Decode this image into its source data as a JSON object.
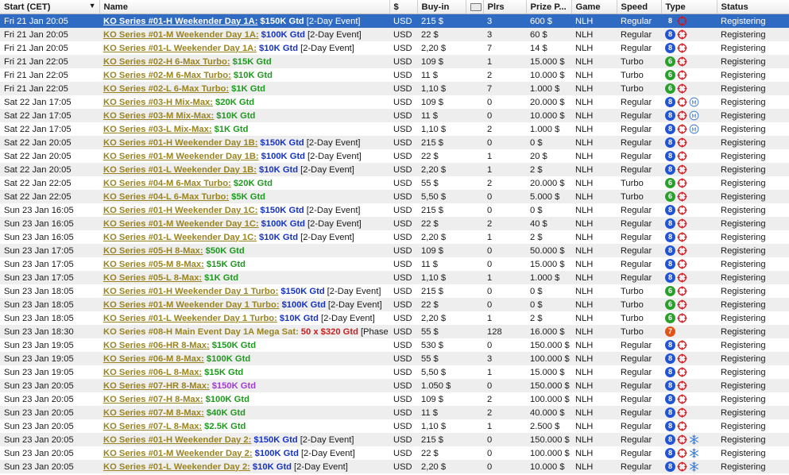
{
  "columns": {
    "start": "Start (CET)",
    "name": "Name",
    "currency": "$",
    "buyin": "Buy-in",
    "ticket": "",
    "players": "Plrs",
    "prize": "Prize P...",
    "game": "Game",
    "speed": "Speed",
    "type": "Type",
    "status": "Status"
  },
  "icons": {
    "start_sort": "caret-down-icon",
    "ticket": "ticket-icon",
    "bounty": "crosshair-icon",
    "mix": "m-circle-icon",
    "freeze": "snowflake-icon"
  },
  "colors": {
    "selected_row": "#2f6bc2",
    "alt_row": "#eeeeee",
    "name_gold": "#9a8420",
    "gtd_blue": "#1633c7",
    "gtd_green": "#1e9a1e",
    "gtd_purple": "#a13cd0",
    "gtd_red": "#c62020",
    "badge_8": "#1f55d4",
    "badge_6": "#27a127",
    "badge_7": "#e0541a",
    "bounty_red": "#d0161d",
    "mix_blue": "#3a78d8",
    "freeze_blue": "#3c7fe0"
  },
  "rows": [
    {
      "start": "Fri 21 Jan 20:05",
      "name": "KO Series #01-H Weekender Day 1A:",
      "gtd": "$150K Gtd",
      "gtd_color": "blue",
      "suffix": "[2-Day Event]",
      "currency": "USD",
      "buyin": "215 $",
      "players": "3",
      "prize": "600 $",
      "game": "NLH",
      "speed": "Regular",
      "badge": "8",
      "icons": [
        "bounty"
      ],
      "status": "Registering",
      "selected": true
    },
    {
      "start": "Fri 21 Jan 20:05",
      "name": "KO Series #01-M Weekender Day 1A:",
      "gtd": "$100K Gtd",
      "gtd_color": "blue",
      "suffix": "[2-Day Event]",
      "currency": "USD",
      "buyin": "22 $",
      "players": "3",
      "prize": "60 $",
      "game": "NLH",
      "speed": "Regular",
      "badge": "8",
      "icons": [
        "bounty"
      ],
      "status": "Registering"
    },
    {
      "start": "Fri 21 Jan 20:05",
      "name": "KO Series #01-L Weekender Day 1A:",
      "gtd": "$10K Gtd",
      "gtd_color": "blue",
      "suffix": "[2-Day Event]",
      "currency": "USD",
      "buyin": "2,20 $",
      "players": "7",
      "prize": "14 $",
      "game": "NLH",
      "speed": "Regular",
      "badge": "8",
      "icons": [
        "bounty"
      ],
      "status": "Registering"
    },
    {
      "start": "Fri 21 Jan 22:05",
      "name": "KO Series #02-H 6-Max Turbo:",
      "gtd": "$15K Gtd",
      "gtd_color": "green",
      "suffix": "",
      "currency": "USD",
      "buyin": "109 $",
      "players": "1",
      "prize": "15.000 $",
      "game": "NLH",
      "speed": "Turbo",
      "badge": "6",
      "icons": [
        "bounty"
      ],
      "status": "Registering"
    },
    {
      "start": "Fri 21 Jan 22:05",
      "name": "KO Series #02-M 6-Max Turbo:",
      "gtd": "$10K Gtd",
      "gtd_color": "green",
      "suffix": "",
      "currency": "USD",
      "buyin": "11 $",
      "players": "2",
      "prize": "10.000 $",
      "game": "NLH",
      "speed": "Turbo",
      "badge": "6",
      "icons": [
        "bounty"
      ],
      "status": "Registering"
    },
    {
      "start": "Fri 21 Jan 22:05",
      "name": "KO Series #02-L 6-Max Turbo:",
      "gtd": "$1K Gtd",
      "gtd_color": "green",
      "suffix": "",
      "currency": "USD",
      "buyin": "1,10 $",
      "players": "7",
      "prize": "1.000 $",
      "game": "NLH",
      "speed": "Turbo",
      "badge": "6",
      "icons": [
        "bounty"
      ],
      "status": "Registering"
    },
    {
      "start": "Sat 22 Jan 17:05",
      "name": "KO Series #03-H Mix-Max:",
      "gtd": "$20K Gtd",
      "gtd_color": "green",
      "suffix": "",
      "currency": "USD",
      "buyin": "109 $",
      "players": "0",
      "prize": "20.000 $",
      "game": "NLH",
      "speed": "Regular",
      "badge": "8",
      "icons": [
        "bounty",
        "mix"
      ],
      "status": "Registering"
    },
    {
      "start": "Sat 22 Jan 17:05",
      "name": "KO Series #03-M Mix-Max:",
      "gtd": "$10K Gtd",
      "gtd_color": "green",
      "suffix": "",
      "currency": "USD",
      "buyin": "11 $",
      "players": "0",
      "prize": "10.000 $",
      "game": "NLH",
      "speed": "Regular",
      "badge": "8",
      "icons": [
        "bounty",
        "mix"
      ],
      "status": "Registering"
    },
    {
      "start": "Sat 22 Jan 17:05",
      "name": "KO Series #03-L Mix-Max:",
      "gtd": "$1K Gtd",
      "gtd_color": "green",
      "suffix": "",
      "currency": "USD",
      "buyin": "1,10 $",
      "players": "2",
      "prize": "1.000 $",
      "game": "NLH",
      "speed": "Regular",
      "badge": "8",
      "icons": [
        "bounty",
        "mix"
      ],
      "status": "Registering"
    },
    {
      "start": "Sat 22 Jan 20:05",
      "name": "KO Series #01-H Weekender Day 1B:",
      "gtd": "$150K Gtd",
      "gtd_color": "blue",
      "suffix": "[2-Day Event]",
      "currency": "USD",
      "buyin": "215 $",
      "players": "0",
      "prize": "0 $",
      "game": "NLH",
      "speed": "Regular",
      "badge": "8",
      "icons": [
        "bounty"
      ],
      "status": "Registering"
    },
    {
      "start": "Sat 22 Jan 20:05",
      "name": "KO Series #01-M Weekender Day 1B:",
      "gtd": "$100K Gtd",
      "gtd_color": "blue",
      "suffix": "[2-Day Event]",
      "currency": "USD",
      "buyin": "22 $",
      "players": "1",
      "prize": "20 $",
      "game": "NLH",
      "speed": "Regular",
      "badge": "8",
      "icons": [
        "bounty"
      ],
      "status": "Registering"
    },
    {
      "start": "Sat 22 Jan 20:05",
      "name": "KO Series #01-L Weekender Day 1B:",
      "gtd": "$10K Gtd",
      "gtd_color": "blue",
      "suffix": "[2-Day Event]",
      "currency": "USD",
      "buyin": "2,20 $",
      "players": "1",
      "prize": "2 $",
      "game": "NLH",
      "speed": "Regular",
      "badge": "8",
      "icons": [
        "bounty"
      ],
      "status": "Registering"
    },
    {
      "start": "Sat 22 Jan 22:05",
      "name": "KO Series #04-M 6-Max Turbo:",
      "gtd": "$20K Gtd",
      "gtd_color": "green",
      "suffix": "",
      "currency": "USD",
      "buyin": "55 $",
      "players": "2",
      "prize": "20.000 $",
      "game": "NLH",
      "speed": "Turbo",
      "badge": "6",
      "icons": [
        "bounty"
      ],
      "status": "Registering"
    },
    {
      "start": "Sat 22 Jan 22:05",
      "name": "KO Series #04-L 6-Max Turbo:",
      "gtd": "$5K Gtd",
      "gtd_color": "green",
      "suffix": "",
      "currency": "USD",
      "buyin": "5,50 $",
      "players": "0",
      "prize": "5.000 $",
      "game": "NLH",
      "speed": "Turbo",
      "badge": "6",
      "icons": [
        "bounty"
      ],
      "status": "Registering"
    },
    {
      "start": "Sun 23 Jan 16:05",
      "name": "KO Series #01-H Weekender Day 1C:",
      "gtd": "$150K Gtd",
      "gtd_color": "blue",
      "suffix": "[2-Day Event]",
      "currency": "USD",
      "buyin": "215 $",
      "players": "0",
      "prize": "0 $",
      "game": "NLH",
      "speed": "Regular",
      "badge": "8",
      "icons": [
        "bounty"
      ],
      "status": "Registering"
    },
    {
      "start": "Sun 23 Jan 16:05",
      "name": "KO Series #01-M Weekender Day 1C:",
      "gtd": "$100K Gtd",
      "gtd_color": "blue",
      "suffix": "[2-Day Event]",
      "currency": "USD",
      "buyin": "22 $",
      "players": "2",
      "prize": "40 $",
      "game": "NLH",
      "speed": "Regular",
      "badge": "8",
      "icons": [
        "bounty"
      ],
      "status": "Registering"
    },
    {
      "start": "Sun 23 Jan 16:05",
      "name": "KO Series #01-L Weekender Day 1C:",
      "gtd": "$10K Gtd",
      "gtd_color": "blue",
      "suffix": "[2-Day Event]",
      "currency": "USD",
      "buyin": "2,20 $",
      "players": "1",
      "prize": "2 $",
      "game": "NLH",
      "speed": "Regular",
      "badge": "8",
      "icons": [
        "bounty"
      ],
      "status": "Registering"
    },
    {
      "start": "Sun 23 Jan 17:05",
      "name": "KO Series #05-H 8-Max:",
      "gtd": "$50K Gtd",
      "gtd_color": "green",
      "suffix": "",
      "currency": "USD",
      "buyin": "109 $",
      "players": "0",
      "prize": "50.000 $",
      "game": "NLH",
      "speed": "Regular",
      "badge": "8",
      "icons": [
        "bounty"
      ],
      "status": "Registering"
    },
    {
      "start": "Sun 23 Jan 17:05",
      "name": "KO Series #05-M 8-Max:",
      "gtd": "$15K Gtd",
      "gtd_color": "green",
      "suffix": "",
      "currency": "USD",
      "buyin": "11 $",
      "players": "0",
      "prize": "15.000 $",
      "game": "NLH",
      "speed": "Regular",
      "badge": "8",
      "icons": [
        "bounty"
      ],
      "status": "Registering"
    },
    {
      "start": "Sun 23 Jan 17:05",
      "name": "KO Series #05-L 8-Max:",
      "gtd": "$1K Gtd",
      "gtd_color": "green",
      "suffix": "",
      "currency": "USD",
      "buyin": "1,10 $",
      "players": "1",
      "prize": "1.000 $",
      "game": "NLH",
      "speed": "Regular",
      "badge": "8",
      "icons": [
        "bounty"
      ],
      "status": "Registering"
    },
    {
      "start": "Sun 23 Jan 18:05",
      "name": "KO Series #01-H Weekender Day 1 Turbo:",
      "gtd": "$150K Gtd",
      "gtd_color": "blue",
      "suffix": "[2-Day Event]",
      "currency": "USD",
      "buyin": "215 $",
      "players": "0",
      "prize": "0 $",
      "game": "NLH",
      "speed": "Turbo",
      "badge": "6",
      "icons": [
        "bounty"
      ],
      "status": "Registering"
    },
    {
      "start": "Sun 23 Jan 18:05",
      "name": "KO Series #01-M Weekender Day 1 Turbo:",
      "gtd": "$100K Gtd",
      "gtd_color": "blue",
      "suffix": "[2-Day Event]",
      "currency": "USD",
      "buyin": "22 $",
      "players": "0",
      "prize": "0 $",
      "game": "NLH",
      "speed": "Turbo",
      "badge": "6",
      "icons": [
        "bounty"
      ],
      "status": "Registering"
    },
    {
      "start": "Sun 23 Jan 18:05",
      "name": "KO Series #01-L Weekender Day 1 Turbo:",
      "gtd": "$10K Gtd",
      "gtd_color": "blue",
      "suffix": "[2-Day Event]",
      "currency": "USD",
      "buyin": "2,20 $",
      "players": "1",
      "prize": "2 $",
      "game": "NLH",
      "speed": "Turbo",
      "badge": "6",
      "icons": [
        "bounty"
      ],
      "status": "Registering"
    },
    {
      "start": "Sun 23 Jan 18:30",
      "name": "KO Series #08-H Main Event Day 1A Mega Sat:",
      "gtd": "50 x $320 Gtd",
      "gtd_color": "red",
      "suffix": "[Phase Fi",
      "currency": "USD",
      "buyin": "55 $",
      "players": "128",
      "prize": "16.000 $",
      "game": "NLH",
      "speed": "Turbo",
      "badge": "7",
      "icons": [],
      "status": "Registering",
      "plain": true
    },
    {
      "start": "Sun 23 Jan 19:05",
      "name": "KO Series #06-HR 8-Max:",
      "gtd": "$150K Gtd",
      "gtd_color": "green",
      "suffix": "",
      "currency": "USD",
      "buyin": "530 $",
      "players": "0",
      "prize": "150.000 $",
      "game": "NLH",
      "speed": "Regular",
      "badge": "8",
      "icons": [
        "bounty"
      ],
      "status": "Registering"
    },
    {
      "start": "Sun 23 Jan 19:05",
      "name": "KO Series #06-M 8-Max:",
      "gtd": "$100K Gtd",
      "gtd_color": "green",
      "suffix": "",
      "currency": "USD",
      "buyin": "55 $",
      "players": "3",
      "prize": "100.000 $",
      "game": "NLH",
      "speed": "Regular",
      "badge": "8",
      "icons": [
        "bounty"
      ],
      "status": "Registering"
    },
    {
      "start": "Sun 23 Jan 19:05",
      "name": "KO Series #06-L 8-Max:",
      "gtd": "$15K Gtd",
      "gtd_color": "green",
      "suffix": "",
      "currency": "USD",
      "buyin": "5,50 $",
      "players": "1",
      "prize": "15.000 $",
      "game": "NLH",
      "speed": "Regular",
      "badge": "8",
      "icons": [
        "bounty"
      ],
      "status": "Registering"
    },
    {
      "start": "Sun 23 Jan 20:05",
      "name": "KO Series #07-HR 8-Max:",
      "gtd": "$150K Gtd",
      "gtd_color": "purple",
      "suffix": "",
      "currency": "USD",
      "buyin": "1.050 $",
      "players": "0",
      "prize": "150.000 $",
      "game": "NLH",
      "speed": "Regular",
      "badge": "8",
      "icons": [
        "bounty"
      ],
      "status": "Registering"
    },
    {
      "start": "Sun 23 Jan 20:05",
      "name": "KO Series #07-H 8-Max:",
      "gtd": "$100K Gtd",
      "gtd_color": "green",
      "suffix": "",
      "currency": "USD",
      "buyin": "109 $",
      "players": "2",
      "prize": "100.000 $",
      "game": "NLH",
      "speed": "Regular",
      "badge": "8",
      "icons": [
        "bounty"
      ],
      "status": "Registering"
    },
    {
      "start": "Sun 23 Jan 20:05",
      "name": "KO Series #07-M 8-Max:",
      "gtd": "$40K Gtd",
      "gtd_color": "green",
      "suffix": "",
      "currency": "USD",
      "buyin": "11 $",
      "players": "2",
      "prize": "40.000 $",
      "game": "NLH",
      "speed": "Regular",
      "badge": "8",
      "icons": [
        "bounty"
      ],
      "status": "Registering"
    },
    {
      "start": "Sun 23 Jan 20:05",
      "name": "KO Series #07-L 8-Max:",
      "gtd": "$2.5K Gtd",
      "gtd_color": "green",
      "suffix": "",
      "currency": "USD",
      "buyin": "1,10 $",
      "players": "1",
      "prize": "2.500 $",
      "game": "NLH",
      "speed": "Regular",
      "badge": "8",
      "icons": [
        "bounty"
      ],
      "status": "Registering"
    },
    {
      "start": "Sun 23 Jan 20:05",
      "name": "KO Series #01-H Weekender Day 2:",
      "gtd": "$150K Gtd",
      "gtd_color": "blue",
      "suffix": "[2-Day Event]",
      "currency": "USD",
      "buyin": "215 $",
      "players": "0",
      "prize": "150.000 $",
      "game": "NLH",
      "speed": "Regular",
      "badge": "8",
      "icons": [
        "bounty",
        "freeze"
      ],
      "status": "Registering"
    },
    {
      "start": "Sun 23 Jan 20:05",
      "name": "KO Series #01-M Weekender Day 2:",
      "gtd": "$100K Gtd",
      "gtd_color": "blue",
      "suffix": "[2-Day Event]",
      "currency": "USD",
      "buyin": "22 $",
      "players": "0",
      "prize": "100.000 $",
      "game": "NLH",
      "speed": "Regular",
      "badge": "8",
      "icons": [
        "bounty",
        "freeze"
      ],
      "status": "Registering"
    },
    {
      "start": "Sun 23 Jan 20:05",
      "name": "KO Series #01-L Weekender Day 2:",
      "gtd": "$10K Gtd",
      "gtd_color": "blue",
      "suffix": "[2-Day Event]",
      "currency": "USD",
      "buyin": "2,20 $",
      "players": "0",
      "prize": "10.000 $",
      "game": "NLH",
      "speed": "Regular",
      "badge": "8",
      "icons": [
        "bounty",
        "freeze"
      ],
      "status": "Registering"
    }
  ]
}
